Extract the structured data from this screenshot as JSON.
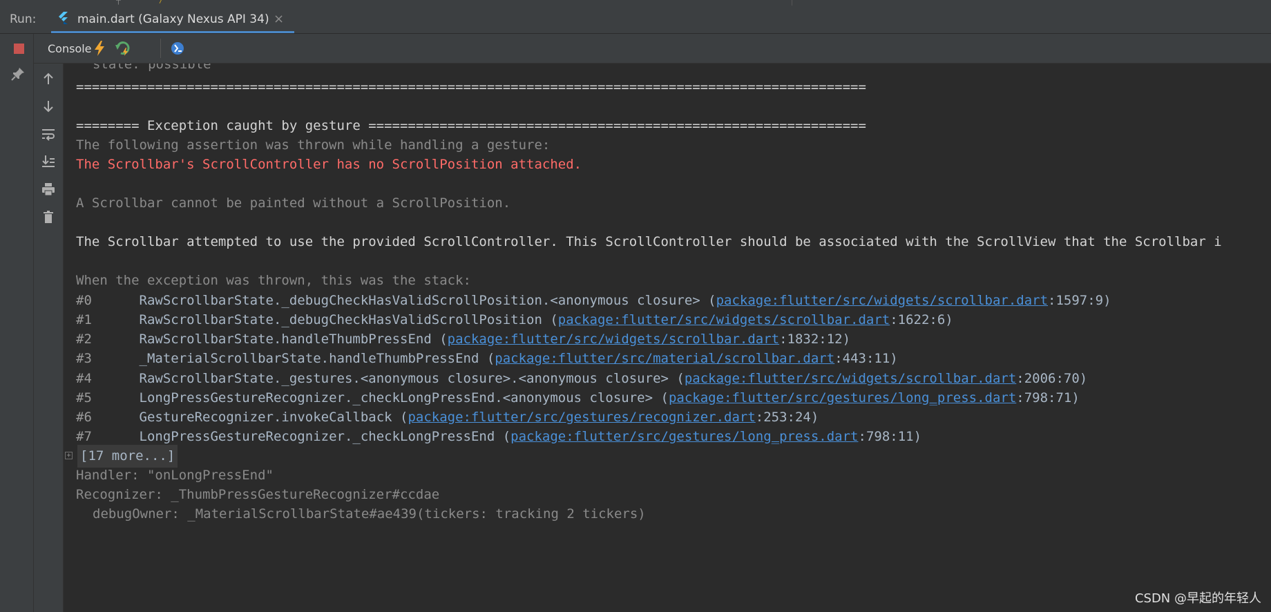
{
  "run_bar": {
    "label": "Run:",
    "tab_title": "main.dart (Galaxy Nexus API 34)",
    "close_glyph": "×"
  },
  "toolbar": {
    "console_tab": "Console"
  },
  "console": {
    "lines": [
      "state: possible",
      "====================================================================================================",
      "======== Exception caught by gesture ===============================================================",
      "The following assertion was thrown while handling a gesture:",
      "The Scrollbar's ScrollController has no ScrollPosition attached.",
      "A Scrollbar cannot be painted without a ScrollPosition.",
      "The Scrollbar attempted to use the provided ScrollController. This ScrollController should be associated with the ScrollView that the Scrollbar i",
      "When the exception was thrown, this was the stack:"
    ],
    "stack": [
      {
        "num": "#0",
        "fn": "RawScrollbarState._debugCheckHasValidScrollPosition.<anonymous closure> (",
        "link": "package:flutter/src/widgets/scrollbar.dart",
        "loc": ":1597:9)"
      },
      {
        "num": "#1",
        "fn": "RawScrollbarState._debugCheckHasValidScrollPosition (",
        "link": "package:flutter/src/widgets/scrollbar.dart",
        "loc": ":1622:6)"
      },
      {
        "num": "#2",
        "fn": "RawScrollbarState.handleThumbPressEnd (",
        "link": "package:flutter/src/widgets/scrollbar.dart",
        "loc": ":1832:12)"
      },
      {
        "num": "#3",
        "fn": "_MaterialScrollbarState.handleThumbPressEnd (",
        "link": "package:flutter/src/material/scrollbar.dart",
        "loc": ":443:11)"
      },
      {
        "num": "#4",
        "fn": "RawScrollbarState._gestures.<anonymous closure>.<anonymous closure> (",
        "link": "package:flutter/src/widgets/scrollbar.dart",
        "loc": ":2006:70)"
      },
      {
        "num": "#5",
        "fn": "LongPressGestureRecognizer._checkLongPressEnd.<anonymous closure> (",
        "link": "package:flutter/src/gestures/long_press.dart",
        "loc": ":798:71)"
      },
      {
        "num": "#6",
        "fn": "GestureRecognizer.invokeCallback (",
        "link": "package:flutter/src/gestures/recognizer.dart",
        "loc": ":253:24)"
      },
      {
        "num": "#7",
        "fn": "LongPressGestureRecognizer._checkLongPressEnd (",
        "link": "package:flutter/src/gestures/long_press.dart",
        "loc": ":798:11)"
      }
    ],
    "more": "[17 more...]",
    "tail": [
      "Handler: \"onLongPressEnd\"",
      "Recognizer: _ThumbPressGestureRecognizer#ccdae",
      "debugOwner: _MaterialScrollbarState#ae439(tickers: tracking 2 tickers)"
    ]
  },
  "watermark": "CSDN @早起的年轻人",
  "colors": {
    "error": "#ff6b68",
    "link": "#4a90d9",
    "stop": "#c75450",
    "tab_underline": "#4a88c7"
  },
  "icons": {
    "tab": "flutter-icon",
    "stop": "stop-icon",
    "pin": "pin-icon",
    "hot_reload": "lightning-icon",
    "hot_restart": "restart-icon",
    "devtools": "devtools-icon",
    "scroll_up": "arrow-up-icon",
    "scroll_down": "arrow-down-icon",
    "soft_wrap": "soft-wrap-icon",
    "scroll_to_end": "scroll-to-end-icon",
    "print": "print-icon",
    "clear": "trash-icon"
  }
}
